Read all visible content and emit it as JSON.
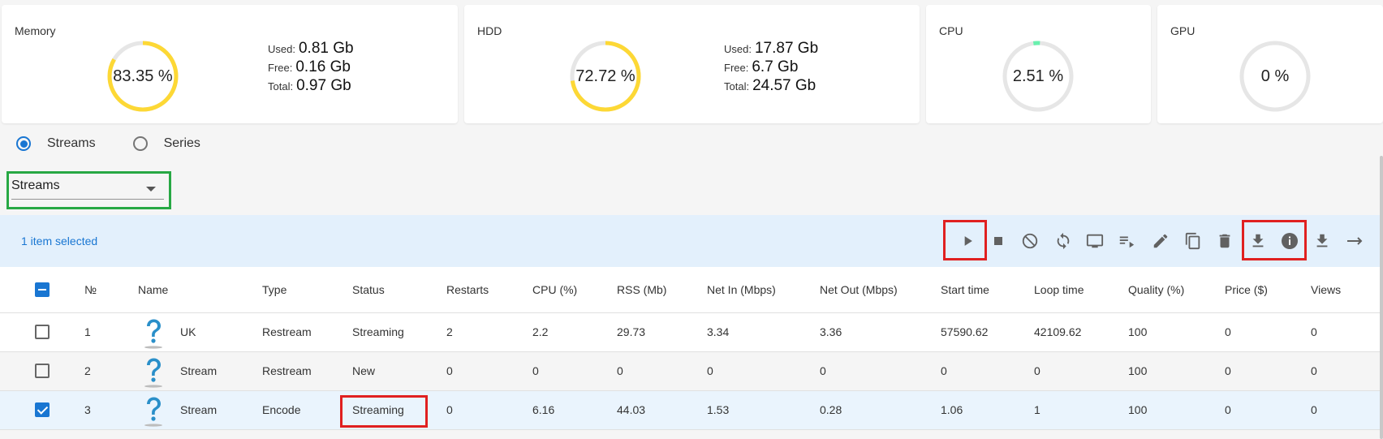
{
  "cards": [
    {
      "title": "Memory",
      "percent": 83.35,
      "value": "83.35 %",
      "color": "#fdd835",
      "stats": [
        {
          "label": "Used:",
          "value": "0.81 Gb"
        },
        {
          "label": "Free:",
          "value": "0.16 Gb"
        },
        {
          "label": "Total:",
          "value": "0.97 Gb"
        }
      ]
    },
    {
      "title": "HDD",
      "percent": 72.72,
      "value": "72.72 %",
      "color": "#fdd835",
      "stats": [
        {
          "label": "Used:",
          "value": "17.87 Gb"
        },
        {
          "label": "Free:",
          "value": "6.7 Gb"
        },
        {
          "label": "Total:",
          "value": "24.57 Gb"
        }
      ]
    },
    {
      "title": "CPU",
      "percent": 2.51,
      "value": "2.51 %",
      "color": "#69f0ae"
    },
    {
      "title": "GPU",
      "percent": 0,
      "value": "0 %",
      "color": "#69f0ae"
    }
  ],
  "mode": {
    "options": [
      "Streams",
      "Series"
    ],
    "selected": "Streams"
  },
  "select": {
    "value": "Streams"
  },
  "toolbar": {
    "selection_text": "1 item selected",
    "icons": [
      "play-icon",
      "stop-icon",
      "block-icon",
      "refresh-icon",
      "monitor-icon",
      "playlist-icon",
      "edit-icon",
      "copy-icon",
      "delete-icon",
      "download-icon",
      "info-icon",
      "download-alt-icon",
      "arrow-right-icon"
    ]
  },
  "table": {
    "headers": [
      "№",
      "Name",
      "Type",
      "Status",
      "Restarts",
      "CPU (%)",
      "RSS (Mb)",
      "Net In (Mbps)",
      "Net Out (Mbps)",
      "Start time",
      "Loop time",
      "Quality (%)",
      "Price ($)",
      "Views"
    ],
    "rows": [
      {
        "checked": false,
        "cells": [
          "1",
          "UK",
          "Restream",
          "Streaming",
          "2",
          "2.2",
          "29.73",
          "3.34",
          "3.36",
          "57590.62",
          "42109.62",
          "100",
          "0",
          "0"
        ]
      },
      {
        "checked": false,
        "cells": [
          "2",
          "Stream",
          "Restream",
          "New",
          "0",
          "0",
          "0",
          "0",
          "0",
          "0",
          "0",
          "100",
          "0",
          "0"
        ]
      },
      {
        "checked": true,
        "cells": [
          "3",
          "Stream",
          "Encode",
          "Streaming",
          "0",
          "6.16",
          "44.03",
          "1.53",
          "0.28",
          "1.06",
          "1",
          "100",
          "0",
          "0"
        ]
      }
    ]
  }
}
